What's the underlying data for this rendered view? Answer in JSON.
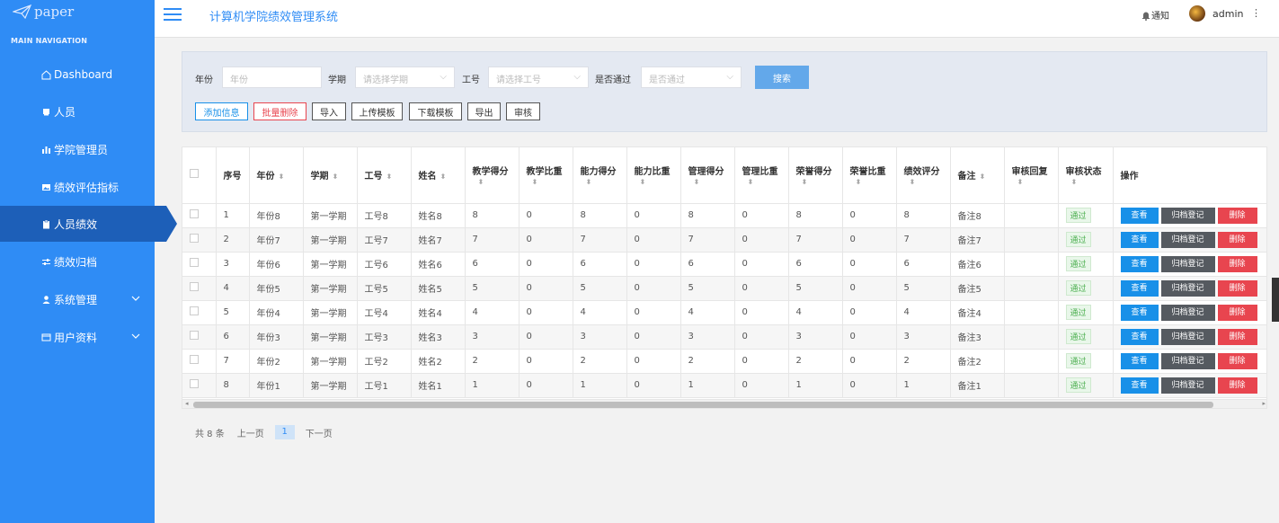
{
  "sidebar": {
    "logo_text": "paper",
    "nav_heading": "MAIN NAVIGATION",
    "items": [
      {
        "label": "Dashboard",
        "icon": "home-icon"
      },
      {
        "label": "人员",
        "icon": "card-icon"
      },
      {
        "label": "学院管理员",
        "icon": "bar-chart-icon"
      },
      {
        "label": "绩效评估指标",
        "icon": "picture-icon"
      },
      {
        "label": "人员绩效",
        "icon": "clipboard-icon",
        "active": true
      },
      {
        "label": "绩效归档",
        "icon": "sliders-icon"
      },
      {
        "label": "系统管理",
        "icon": "user-icon",
        "expandable": true
      },
      {
        "label": "用户资料",
        "icon": "window-icon",
        "expandable": true
      }
    ]
  },
  "header": {
    "title": "计算机学院绩效管理系统",
    "notice_label": "通知",
    "username": "admin"
  },
  "search": {
    "year_label": "年份",
    "year_placeholder": "年份",
    "term_label": "学期",
    "term_placeholder": "请选择学期",
    "staff_label": "工号",
    "staff_placeholder": "请选择工号",
    "pass_label": "是否通过",
    "pass_placeholder": "是否通过",
    "search_button": "搜索"
  },
  "actions": [
    "添加信息",
    "批量删除",
    "导入",
    "上传模板",
    "下载模板",
    "导出",
    "审核"
  ],
  "table": {
    "headers": [
      "序号",
      "年份",
      "学期",
      "工号",
      "姓名",
      "教学得分",
      "教学比重",
      "能力得分",
      "能力比重",
      "管理得分",
      "管理比重",
      "荣誉得分",
      "荣誉比重",
      "绩效评分",
      "备注",
      "审核回复",
      "审核状态",
      "操作"
    ],
    "rows": [
      {
        "no": "1",
        "year": "年份8",
        "term": "第一学期",
        "staff": "工号8",
        "name": "姓名8",
        "teach": "8",
        "teach_w": "0",
        "ability": "8",
        "ability_w": "0",
        "manage": "8",
        "manage_w": "0",
        "honor": "8",
        "honor_w": "0",
        "score": "8",
        "remark": "备注8",
        "reply": "",
        "status": "通过"
      },
      {
        "no": "2",
        "year": "年份7",
        "term": "第一学期",
        "staff": "工号7",
        "name": "姓名7",
        "teach": "7",
        "teach_w": "0",
        "ability": "7",
        "ability_w": "0",
        "manage": "7",
        "manage_w": "0",
        "honor": "7",
        "honor_w": "0",
        "score": "7",
        "remark": "备注7",
        "reply": "",
        "status": "通过"
      },
      {
        "no": "3",
        "year": "年份6",
        "term": "第一学期",
        "staff": "工号6",
        "name": "姓名6",
        "teach": "6",
        "teach_w": "0",
        "ability": "6",
        "ability_w": "0",
        "manage": "6",
        "manage_w": "0",
        "honor": "6",
        "honor_w": "0",
        "score": "6",
        "remark": "备注6",
        "reply": "",
        "status": "通过"
      },
      {
        "no": "4",
        "year": "年份5",
        "term": "第一学期",
        "staff": "工号5",
        "name": "姓名5",
        "teach": "5",
        "teach_w": "0",
        "ability": "5",
        "ability_w": "0",
        "manage": "5",
        "manage_w": "0",
        "honor": "5",
        "honor_w": "0",
        "score": "5",
        "remark": "备注5",
        "reply": "",
        "status": "通过"
      },
      {
        "no": "5",
        "year": "年份4",
        "term": "第一学期",
        "staff": "工号4",
        "name": "姓名4",
        "teach": "4",
        "teach_w": "0",
        "ability": "4",
        "ability_w": "0",
        "manage": "4",
        "manage_w": "0",
        "honor": "4",
        "honor_w": "0",
        "score": "4",
        "remark": "备注4",
        "reply": "",
        "status": "通过"
      },
      {
        "no": "6",
        "year": "年份3",
        "term": "第一学期",
        "staff": "工号3",
        "name": "姓名3",
        "teach": "3",
        "teach_w": "0",
        "ability": "3",
        "ability_w": "0",
        "manage": "3",
        "manage_w": "0",
        "honor": "3",
        "honor_w": "0",
        "score": "3",
        "remark": "备注3",
        "reply": "",
        "status": "通过"
      },
      {
        "no": "7",
        "year": "年份2",
        "term": "第一学期",
        "staff": "工号2",
        "name": "姓名2",
        "teach": "2",
        "teach_w": "0",
        "ability": "2",
        "ability_w": "0",
        "manage": "2",
        "manage_w": "0",
        "honor": "2",
        "honor_w": "0",
        "score": "2",
        "remark": "备注2",
        "reply": "",
        "status": "通过"
      },
      {
        "no": "8",
        "year": "年份1",
        "term": "第一学期",
        "staff": "工号1",
        "name": "姓名1",
        "teach": "1",
        "teach_w": "0",
        "ability": "1",
        "ability_w": "0",
        "manage": "1",
        "manage_w": "0",
        "honor": "1",
        "honor_w": "0",
        "score": "1",
        "remark": "备注1",
        "reply": "",
        "status": "通过"
      }
    ],
    "row_actions": {
      "view": "查看",
      "archive": "归档登记",
      "delete": "删除"
    }
  },
  "pagination": {
    "total": "共 8 条",
    "prev": "上一页",
    "current": "1",
    "next": "下一页"
  },
  "colors": {
    "sidebar": "#2f8cf5",
    "active_nav": "#1d5fb8",
    "view": "#1890e8",
    "archive": "#555a60",
    "delete": "#e8454f"
  }
}
